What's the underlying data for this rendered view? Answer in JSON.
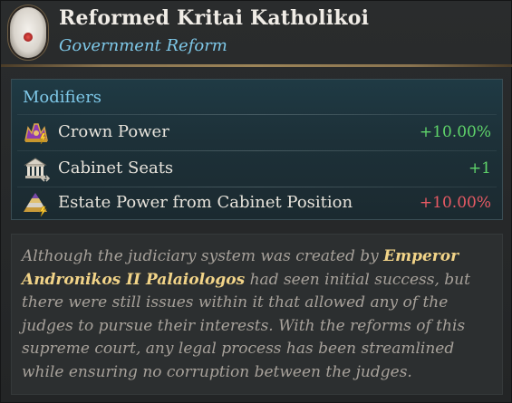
{
  "header": {
    "title": "Reformed Kritai Katholikoi",
    "subtitle": "Government Reform"
  },
  "modifiers": {
    "heading": "Modifiers",
    "items": [
      {
        "icon": "crown-power-icon",
        "label": "Crown Power",
        "value": "+10.00%",
        "color": "#5fd46a"
      },
      {
        "icon": "cabinet-building-icon",
        "label": "Cabinet Seats",
        "value": "+1",
        "color": "#5fd46a"
      },
      {
        "icon": "estate-pyramid-icon",
        "label": "Estate Power from Cabinet Position",
        "value": "+10.00%",
        "color": "#e85a64"
      }
    ]
  },
  "description": {
    "part1": "Although the judiciary system was created by ",
    "highlight": "Emperor Andronikos II Palaiologos",
    "part2": " had seen initial success, but there were still issues within it that allowed any of the judges to pursue their interests. With the reforms of this supreme court, any legal process has been streamlined while ensuring no corruption between the judges."
  },
  "colors": {
    "title": "#f0ece6",
    "subtitle_accent": "#7ec8e8",
    "highlight": "#f2d488",
    "positive": "#5fd46a",
    "negative": "#e85a64"
  }
}
